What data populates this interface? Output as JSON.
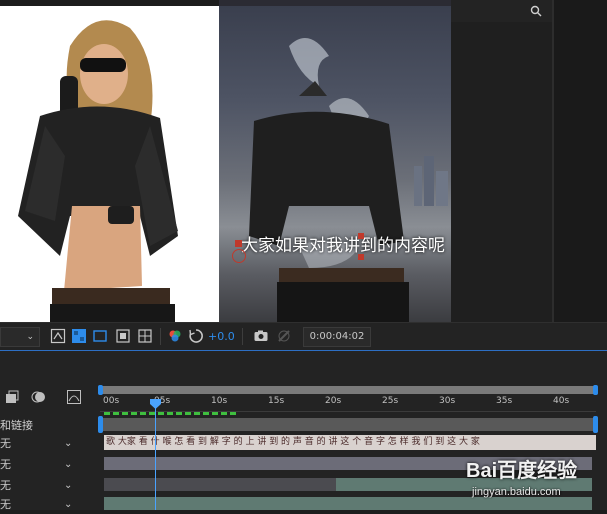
{
  "caption": "大家如果对我讲到的内容呢",
  "control_bar": {
    "exposure_value": "+0.0",
    "timecode": "0:00:04:02"
  },
  "timeline": {
    "ruler_labels": [
      "00s",
      "05s",
      "10s",
      "15s",
      "20s",
      "25s",
      "30s",
      "35s",
      "40s"
    ],
    "playhead_time": "0:00:04:02",
    "layers_header": "和链接",
    "layer_rows": [
      {
        "label": "无"
      },
      {
        "label": "无"
      },
      {
        "label": "无"
      },
      {
        "label": "无"
      }
    ],
    "text_track": "歌 大家 看 什 喉 怎 看 到 解 字 的 上 讲 到 的 声 音 的 讲 这 个 音 字 怎 样 我 们 到 这 大 家"
  },
  "watermark": {
    "brand": "Bai百度经验",
    "url": "jingyan.baidu.com"
  },
  "colors": {
    "accent_blue": "#2d8ceb",
    "playhead": "#4aa3ff",
    "work_area": "#7a7a7a",
    "layer_bar": "#6c6c78",
    "layer_bar_teal": "#5f7a72",
    "label_red": "#c0392b"
  }
}
